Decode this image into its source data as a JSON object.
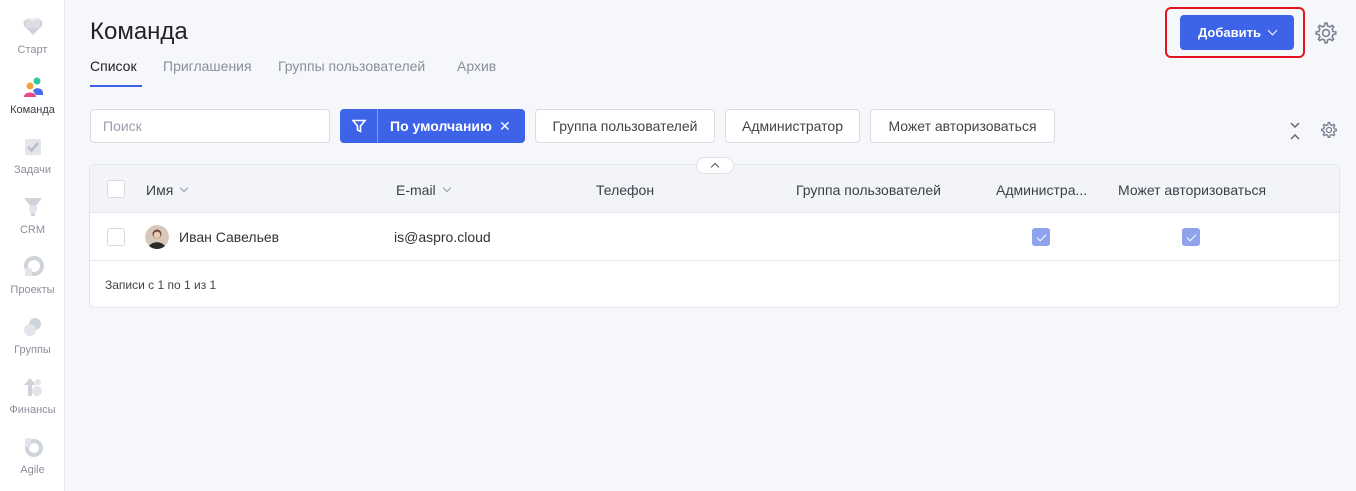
{
  "sidebar": {
    "items": [
      {
        "label": "Старт",
        "icon": "heart-icon"
      },
      {
        "label": "Команда",
        "icon": "team-icon"
      },
      {
        "label": "Задачи",
        "icon": "tasks-icon"
      },
      {
        "label": "CRM",
        "icon": "crm-icon"
      },
      {
        "label": "Проекты",
        "icon": "projects-icon"
      },
      {
        "label": "Группы",
        "icon": "groups-icon"
      },
      {
        "label": "Финансы",
        "icon": "finance-icon"
      },
      {
        "label": "Agile",
        "icon": "agile-icon"
      }
    ],
    "active": "Команда"
  },
  "header": {
    "title": "Команда",
    "add_label": "Добавить"
  },
  "tabs": [
    {
      "label": "Список",
      "active": true
    },
    {
      "label": "Приглашения",
      "active": false
    },
    {
      "label": "Группы пользователей",
      "active": false
    },
    {
      "label": "Архив",
      "active": false
    }
  ],
  "filters": {
    "search_placeholder": "Поиск",
    "active_filter": "По умолчанию",
    "chips": [
      "Группа пользователей",
      "Администратор",
      "Может авторизоваться"
    ]
  },
  "table": {
    "columns": [
      "Имя",
      "E-mail",
      "Телефон",
      "Группа пользователей",
      "Администра...",
      "Может авторизоваться"
    ],
    "rows": [
      {
        "name": "Иван Савельев",
        "email": "is@aspro.cloud",
        "phone": "",
        "group": "",
        "admin": true,
        "can_login": true
      }
    ],
    "footer": "Записи с 1 по 1 из 1"
  },
  "colors": {
    "accent": "#3d63e8",
    "highlight": "#e0151f",
    "checked": "#8ea3ec"
  }
}
